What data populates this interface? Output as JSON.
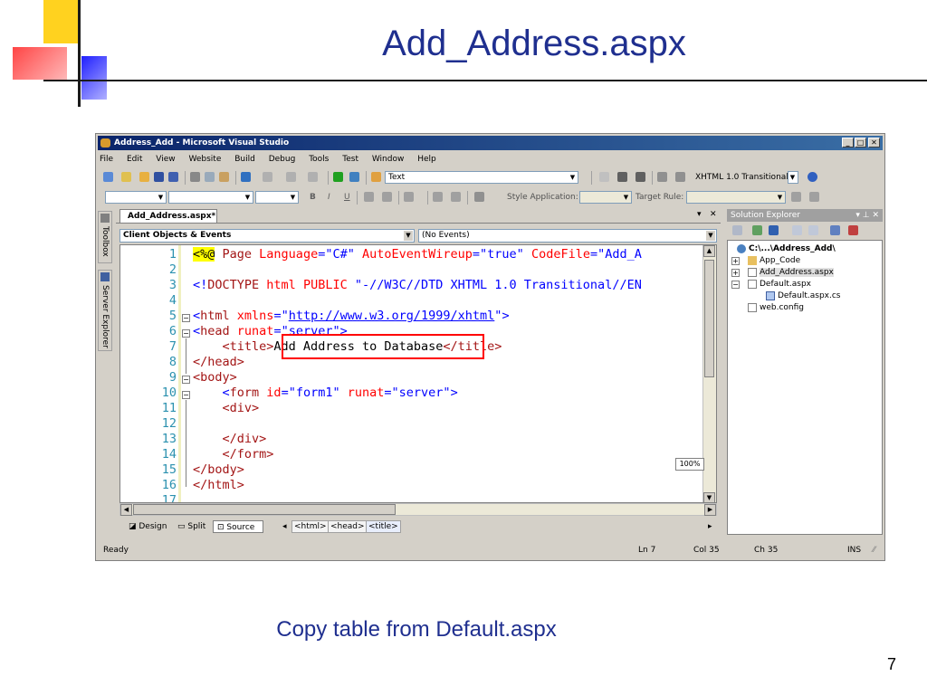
{
  "slide": {
    "title": "Add_Address.aspx",
    "caption": "Copy table from Default.aspx",
    "page_number": "7"
  },
  "window": {
    "title": "Address_Add - Microsoft Visual Studio",
    "min_glyph": "_",
    "max_glyph": "□",
    "close_glyph": "✕"
  },
  "menu": [
    "File",
    "Edit",
    "View",
    "Website",
    "Build",
    "Debug",
    "Tools",
    "Test",
    "Window",
    "Help"
  ],
  "toolbar1": {
    "find_value": "Text",
    "schema_value": "XHTML 1.0 Transitional ("
  },
  "toolbar2": {
    "bold": "B",
    "italic": "I",
    "underline": "U",
    "style_application_label": "Style Application:",
    "target_rule_label": "Target Rule:"
  },
  "sidebar": {
    "toolbox": "Toolbox",
    "server_explorer": "Server Explorer"
  },
  "editor": {
    "tab_label": "Add_Address.aspx*",
    "tab_arrow": "▾",
    "tab_close": "✕",
    "objects_combo": "Client Objects & Events",
    "events_combo": "(No Events)",
    "line_numbers": [
      "1",
      "2",
      "3",
      "4",
      "5",
      "6",
      "7",
      "8",
      "9",
      "10",
      "11",
      "12",
      "13",
      "14",
      "15",
      "16",
      "17"
    ],
    "lines": {
      "l1_open": "<%@",
      "l1_page": " Page ",
      "l1_lang_attr": "Language",
      "l1_eq1": "=",
      "l1_lang_val": "\"C#\"",
      "l1_auto_attr": " AutoEventWireup",
      "l1_eq2": "=",
      "l1_auto_val": "\"true\"",
      "l1_cf_attr": " CodeFile",
      "l1_eq3": "=",
      "l1_cf_val": "\"Add_A",
      "l3_open": "<!",
      "l3_doctype": "DOCTYPE",
      "l3_html": " html",
      "l3_public": " PUBLIC",
      "l3_str": " \"-//W3C//DTD XHTML 1.0 Transitional//EN",
      "l5_lt": "<",
      "l5_tag": "html",
      "l5_attr": " xmlns",
      "l5_eq": "=",
      "l5_q1": "\"",
      "l5_url": "http://www.w3.org/1999/xhtml",
      "l5_q2": "\"",
      "l5_gt": ">",
      "l6_lt": "<",
      "l6_tag": "head",
      "l6_attr": " runat",
      "l6_eq": "=",
      "l6_val": "\"server\"",
      "l6_gt": ">",
      "l7_open": "<title>",
      "l7_text": "Add Address to Database",
      "l7_close": "</title>",
      "l8": "</head>",
      "l9": "<body>",
      "l10_lt": "<",
      "l10_tag": "form",
      "l10_id_attr": " id",
      "l10_eq1": "=",
      "l10_id_val": "\"form1\"",
      "l10_runat_attr": " runat",
      "l10_eq2": "=",
      "l10_runat_val": "\"server\"",
      "l10_gt": ">",
      "l11": "<div>",
      "l13": "</div>",
      "l14": "</form>",
      "l15": "</body>",
      "l16": "</html>"
    },
    "zoom": "100%",
    "view_tabs": [
      "Design",
      "Split",
      "Source"
    ],
    "breadcrumbs": [
      "<html>",
      "<head>",
      "<title>"
    ]
  },
  "solution_explorer": {
    "title": "Solution Explorer",
    "pin": "▾ ⊥ ✕",
    "items": [
      "C:\\...\\Address_Add\\",
      "App_Code",
      "Add_Address.aspx",
      "Default.aspx",
      "Default.aspx.cs",
      "web.config"
    ]
  },
  "status": {
    "ready": "Ready",
    "ln": "Ln 7",
    "col": "Col 35",
    "ch": "Ch 35",
    "ins": "INS"
  },
  "colors": {
    "title_blue": "#1f2f8f",
    "highlight_red": "#ff0000",
    "keyword_blue": "#0000ff",
    "tag_maroon": "#a31515",
    "line_number_teal": "#2b91af"
  }
}
